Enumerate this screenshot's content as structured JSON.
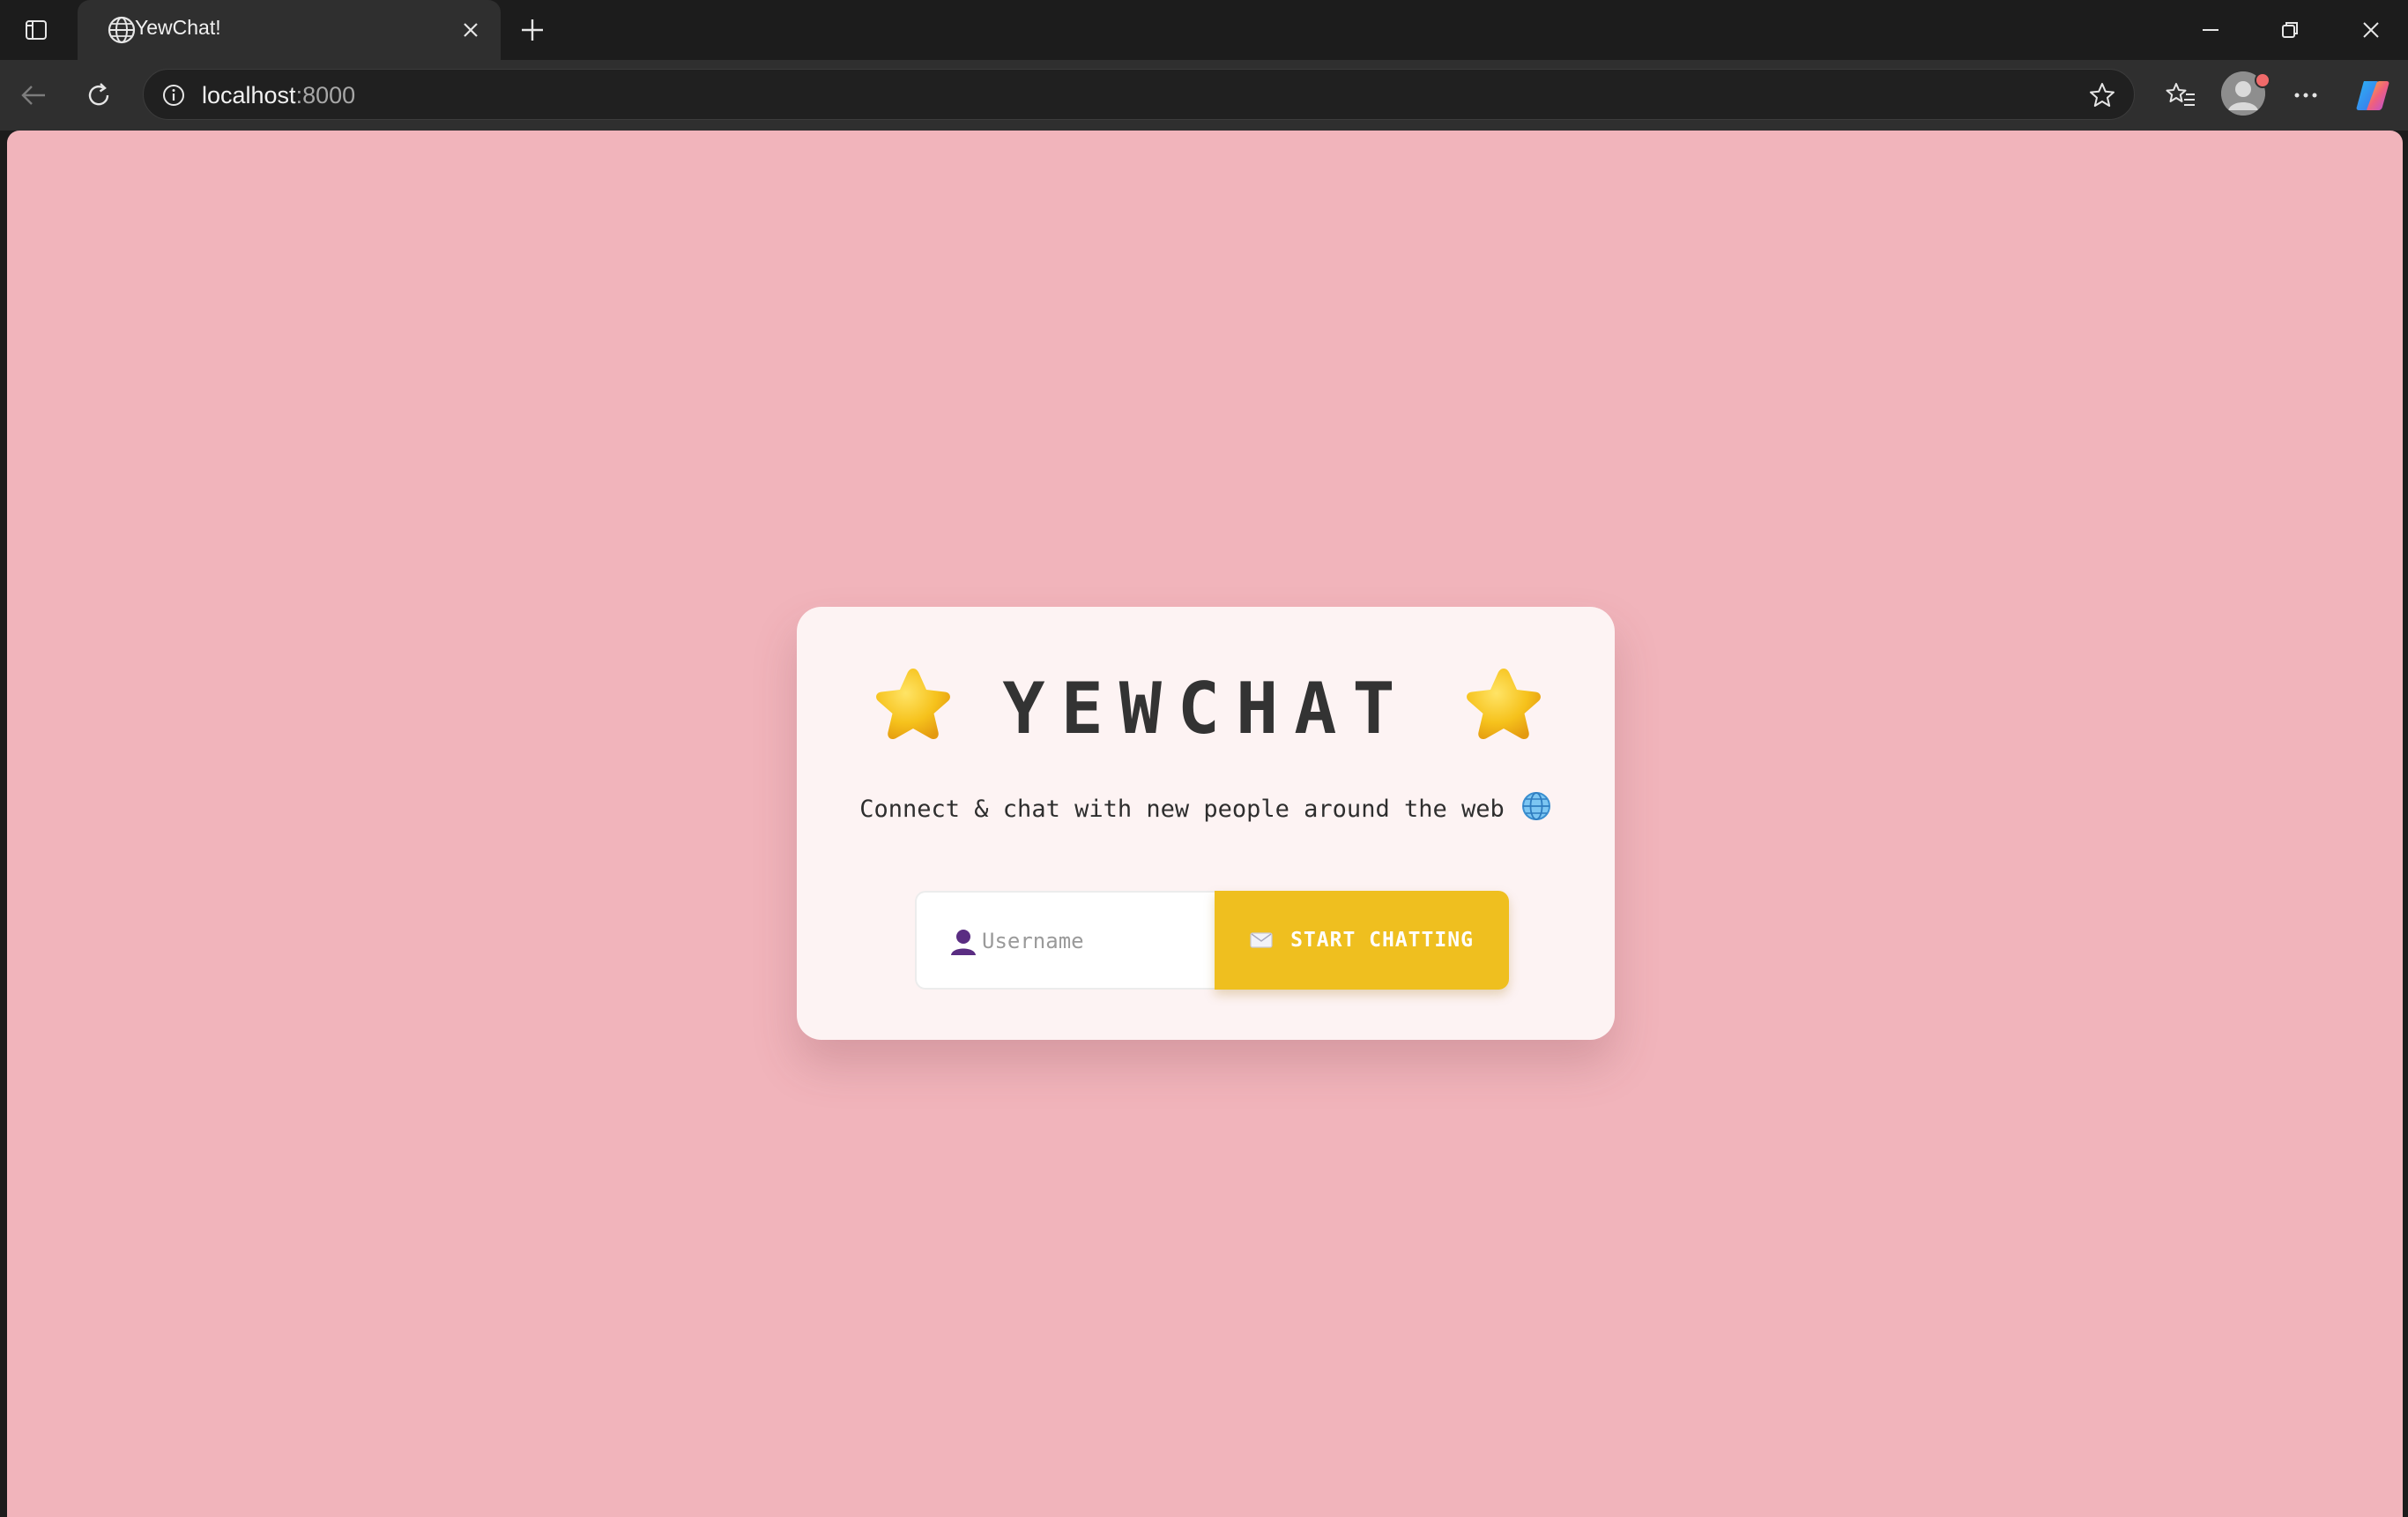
{
  "browser": {
    "tab": {
      "title": "YewChat!",
      "icon": "globe-icon"
    },
    "address": {
      "host": "localhost",
      "port": ":8000"
    },
    "icons": {
      "sidebar": "sidebar-toggle-icon",
      "close_tab": "close-icon",
      "new_tab": "plus-icon",
      "back": "back-arrow-icon",
      "reload": "reload-icon",
      "info": "info-icon",
      "favorite": "star-outline-icon",
      "favorites": "favorites-icon",
      "profile": "profile-avatar",
      "more": "more-icon",
      "copilot": "copilot-icon",
      "minimize": "minimize-icon",
      "restore": "restore-icon",
      "close_window": "close-window-icon"
    }
  },
  "app": {
    "brand": "YEWCHAT",
    "tagline": "Connect & chat with new people around the web",
    "username_placeholder": "Username",
    "start_label": "START CHATTING",
    "colors": {
      "background": "#f1b4bb",
      "card": "#fdf3f3",
      "button": "#efbf1f",
      "text": "#333333"
    }
  }
}
